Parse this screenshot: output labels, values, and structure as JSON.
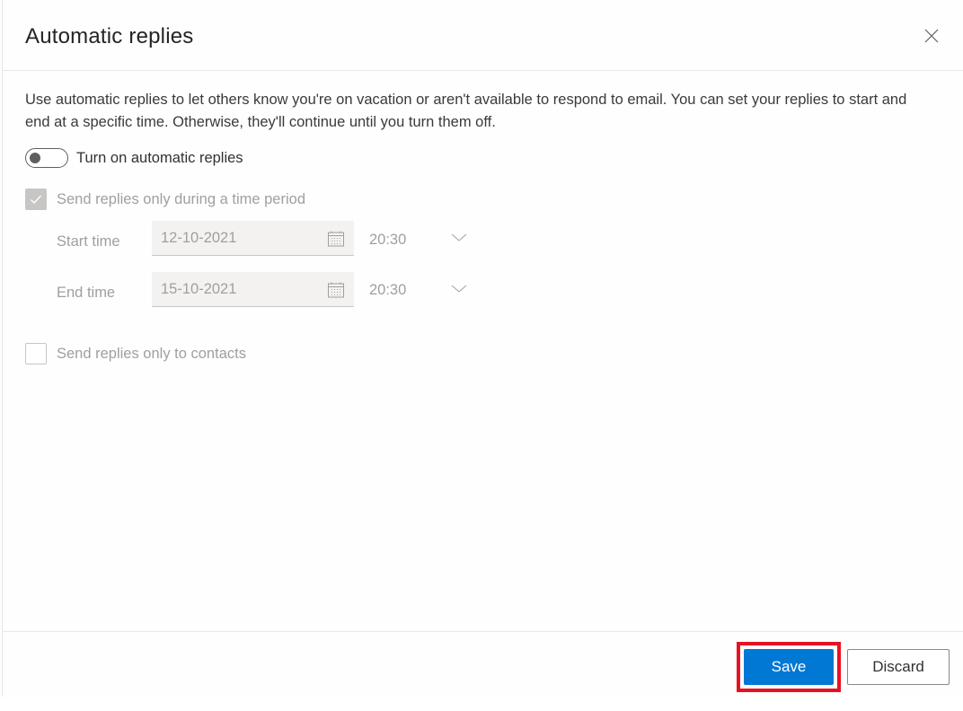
{
  "dialog": {
    "title": "Automatic replies",
    "close_icon": "close-icon",
    "description": "Use automatic replies to let others know you're on vacation or aren't available to respond to email. You can set your replies to start and end at a specific time. Otherwise, they'll continue until you turn them off."
  },
  "toggle": {
    "label": "Turn on automatic replies",
    "on": false
  },
  "time_period": {
    "label": "Send replies only during a time period",
    "checked": true,
    "disabled": true,
    "start": {
      "label": "Start time",
      "date": "12-10-2021",
      "time": "20:30"
    },
    "end": {
      "label": "End time",
      "date": "15-10-2021",
      "time": "20:30"
    }
  },
  "contacts_only": {
    "label": "Send replies only to contacts",
    "checked": false,
    "disabled": true
  },
  "footer": {
    "save_label": "Save",
    "discard_label": "Discard"
  },
  "colors": {
    "primary": "#0078d4",
    "highlight": "#e81123",
    "disabled_text": "#a19f9d"
  }
}
